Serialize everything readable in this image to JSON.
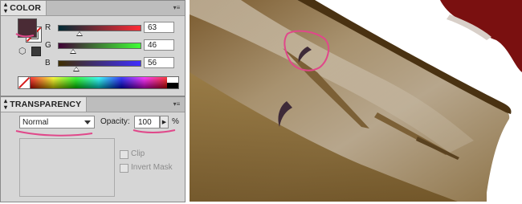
{
  "color_panel": {
    "title": "COLOR",
    "fill_color": "#4a2b35",
    "channels": [
      {
        "label": "R",
        "value": "63",
        "thumb_pct": 0.25,
        "gradient_start": "#002b35",
        "gradient_end": "#ff2b35"
      },
      {
        "label": "G",
        "value": "46",
        "thumb_pct": 0.18,
        "gradient_start": "#3f0035",
        "gradient_end": "#3fff35"
      },
      {
        "label": "B",
        "value": "56",
        "thumb_pct": 0.22,
        "gradient_start": "#3f2e00",
        "gradient_end": "#3f2eff"
      }
    ]
  },
  "transparency_panel": {
    "title": "TRANSPARENCY",
    "blend_mode": "Normal",
    "opacity_label": "Opacity:",
    "opacity_value": "100",
    "opacity_unit": "%",
    "clip_label": "Clip",
    "invert_mask_label": "Invert Mask"
  },
  "icons": {
    "panel_collapse": "double-arrow-icon",
    "panel_menu": "panel-menu-icon",
    "gamut": "cube-icon",
    "web_safe": "square-icon",
    "opacity_step": "right-triangle-icon"
  },
  "colors": {
    "annotation": "#e0488a",
    "panel_bg": "#d6d6d6",
    "feather_dark": "#6b4a20",
    "feather_light": "#c9b69a",
    "red_shape": "#7a1010",
    "mark": "#3e2a38"
  }
}
